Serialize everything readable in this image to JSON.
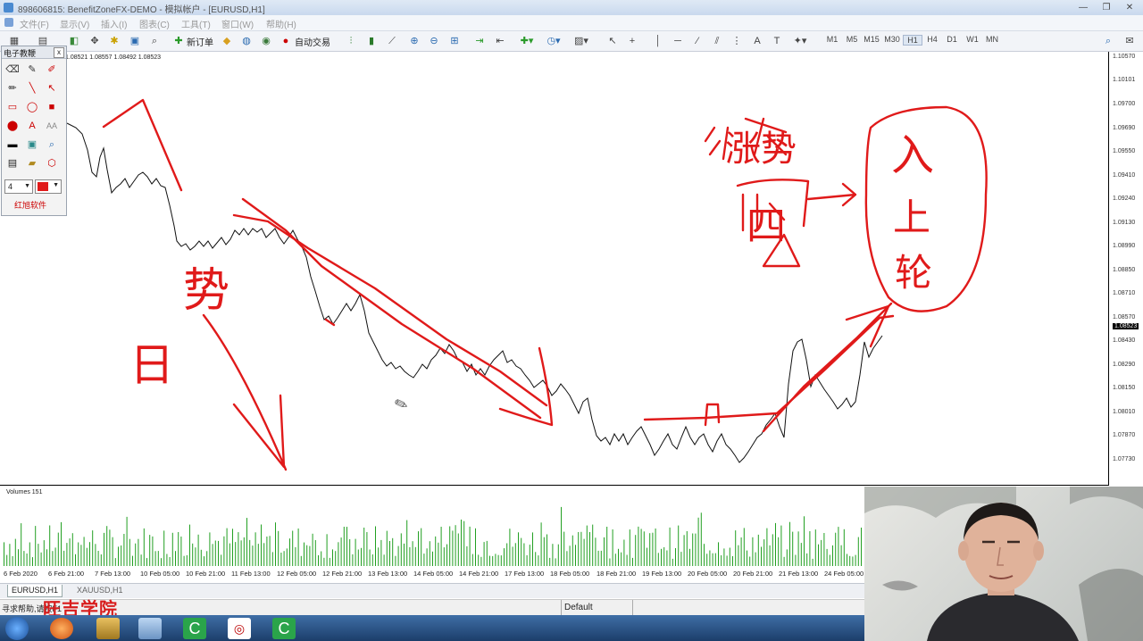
{
  "window": {
    "title": "898606815: BenefitZoneFX-DEMO - 模拟帐户 - [EURUSD,H1]",
    "controls": [
      "—",
      "❐",
      "✕"
    ]
  },
  "menu": [
    "文件(F)",
    "显示(V)",
    "插入(I)",
    "图表(C)",
    "工具(T)",
    "窗口(W)",
    "帮助(H)"
  ],
  "toolbar": {
    "new_order": "新订单",
    "auto_trading": "自动交易",
    "timeframes": [
      "M1",
      "M5",
      "M15",
      "M30",
      "H1",
      "H4",
      "D1",
      "W1",
      "MN"
    ],
    "selected_timeframe": "H1"
  },
  "chart": {
    "ohlc_text": "1.08521 1.08557 1.08492 1.08523",
    "price_labels": [
      "1.10570",
      "1.10101",
      "1.09700",
      "1.09690",
      "1.09550",
      "1.09410",
      "1.09240",
      "1.09130",
      "1.08990",
      "1.08850",
      "1.08710",
      "1.08570",
      "1.08523",
      "1.08430",
      "1.08290",
      "1.08150",
      "1.08010",
      "1.07870",
      "1.07730"
    ],
    "current_price": "1.08523"
  },
  "palette": {
    "title": "电子教鞭",
    "close": "x",
    "width_value": "4",
    "brand": "红旭软件"
  },
  "volume": {
    "label": "Volumes 151"
  },
  "time_labels": [
    "6 Feb 2020",
    "6 Feb 21:00",
    "7 Feb 13:00",
    "10 Feb 05:00",
    "10 Feb 21:00",
    "11 Feb 13:00",
    "12 Feb 05:00",
    "12 Feb 21:00",
    "13 Feb 13:00",
    "14 Feb 05:00",
    "14 Feb 21:00",
    "17 Feb 13:00",
    "18 Feb 05:00",
    "18 Feb 21:00",
    "19 Feb 13:00",
    "20 Feb 05:00",
    "20 Feb 21:00",
    "21 Feb 13:00",
    "24 Feb 05:00"
  ],
  "tabs": [
    "EURUSD,H1",
    "XAUUSD,H1"
  ],
  "status": {
    "help": "寻求帮助,请按F1",
    "profile": "Default",
    "overlay_logo": "旺吉学院"
  },
  "annotations": {
    "left_top": "势",
    "left_bottom": "日",
    "right_top": "涨势",
    "right_middle": "四",
    "circle_text": [
      "入",
      "上",
      "轮"
    ]
  },
  "colors": {
    "ink": "#e01a1a",
    "price_line": "#111111",
    "volume_bar": "#22a022"
  }
}
